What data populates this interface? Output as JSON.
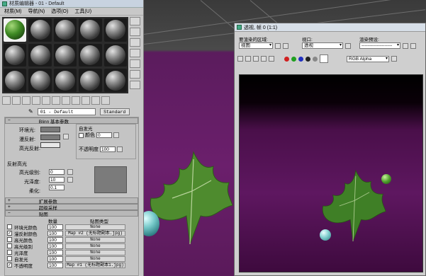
{
  "material_editor": {
    "title": "材质编辑器 - 01 - Default",
    "menu": [
      "材质(M)",
      "导航(N)",
      "选项(O)",
      "工具(U)"
    ],
    "material_name": "01 - Default",
    "material_type": "Standard",
    "rollouts": {
      "basic_params": "Blinn 基本参数",
      "extended": "扩展参数",
      "supersampling": "超级采样",
      "maps": "贴图"
    },
    "labels": {
      "ambient": "环境光:",
      "diffuse": "漫反射:",
      "specular": "高光反射:",
      "self_illum": "自发光",
      "color": "颜色",
      "opacity": "不透明度",
      "spec_highlights": "反射高光",
      "spec_level": "高光级别:",
      "glossiness": "光泽度:",
      "soften": "柔化:"
    },
    "values": {
      "self_illum_value": "0",
      "opacity_value": "100",
      "spec_level_value": "0",
      "glossiness_value": "10",
      "soften_value": "0.1"
    },
    "maps_header": {
      "amount": "数量",
      "map_type": "贴图类型"
    },
    "maps": [
      {
        "name": "环境光颜色",
        "checked": false,
        "amount": "100",
        "map": "None"
      },
      {
        "name": "漫反射颜色",
        "checked": true,
        "amount": "100",
        "map": "Map #2 (无标题副本.jpg)"
      },
      {
        "name": "高光颜色",
        "checked": false,
        "amount": "100",
        "map": "None"
      },
      {
        "name": "高光级别",
        "checked": false,
        "amount": "100",
        "map": "None"
      },
      {
        "name": "光泽度",
        "checked": false,
        "amount": "100",
        "map": "None"
      },
      {
        "name": "自发光",
        "checked": false,
        "amount": "100",
        "map": "None"
      },
      {
        "name": "不透明度",
        "checked": true,
        "amount": "100",
        "map": "Map #1 (无标题副本1.jpg)"
      }
    ]
  },
  "render_window": {
    "title": "透视, 帧 0 (1:1)",
    "area_label": "要渲染的区域:",
    "area_value": "视图",
    "viewport_label": "视口:",
    "viewport_value": "透视",
    "preset_label": "渲染预设:",
    "preset_value": "--------------------",
    "channel_value": "RGB Alpha",
    "channel_colors": [
      "#d02020",
      "#20a020",
      "#2030c0",
      "#ffffff",
      "#888888"
    ]
  }
}
